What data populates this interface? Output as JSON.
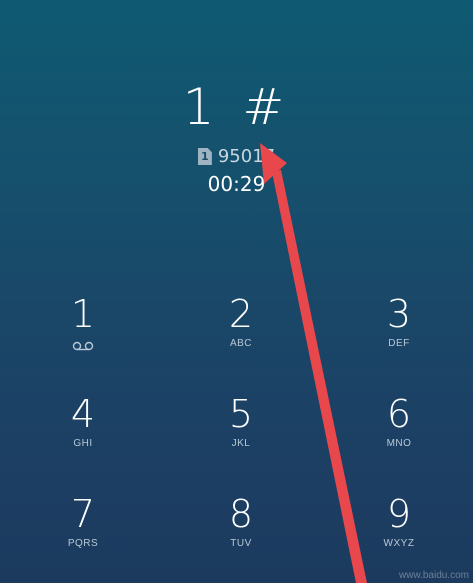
{
  "call": {
    "dialed_digits": "1 #",
    "sim_number": "1",
    "number": "95017",
    "timer": "00:29"
  },
  "keypad": [
    {
      "digit": "1",
      "letters": "",
      "icon": "voicemail-icon"
    },
    {
      "digit": "2",
      "letters": "ABC"
    },
    {
      "digit": "3",
      "letters": "DEF"
    },
    {
      "digit": "4",
      "letters": "GHI"
    },
    {
      "digit": "5",
      "letters": "JKL"
    },
    {
      "digit": "6",
      "letters": "MNO"
    },
    {
      "digit": "7",
      "letters": "PQRS"
    },
    {
      "digit": "8",
      "letters": "TUV"
    },
    {
      "digit": "9",
      "letters": "WXYZ"
    }
  ],
  "annotation": {
    "arrow_color": "#e8474c"
  },
  "watermark": "www.baidu.com"
}
